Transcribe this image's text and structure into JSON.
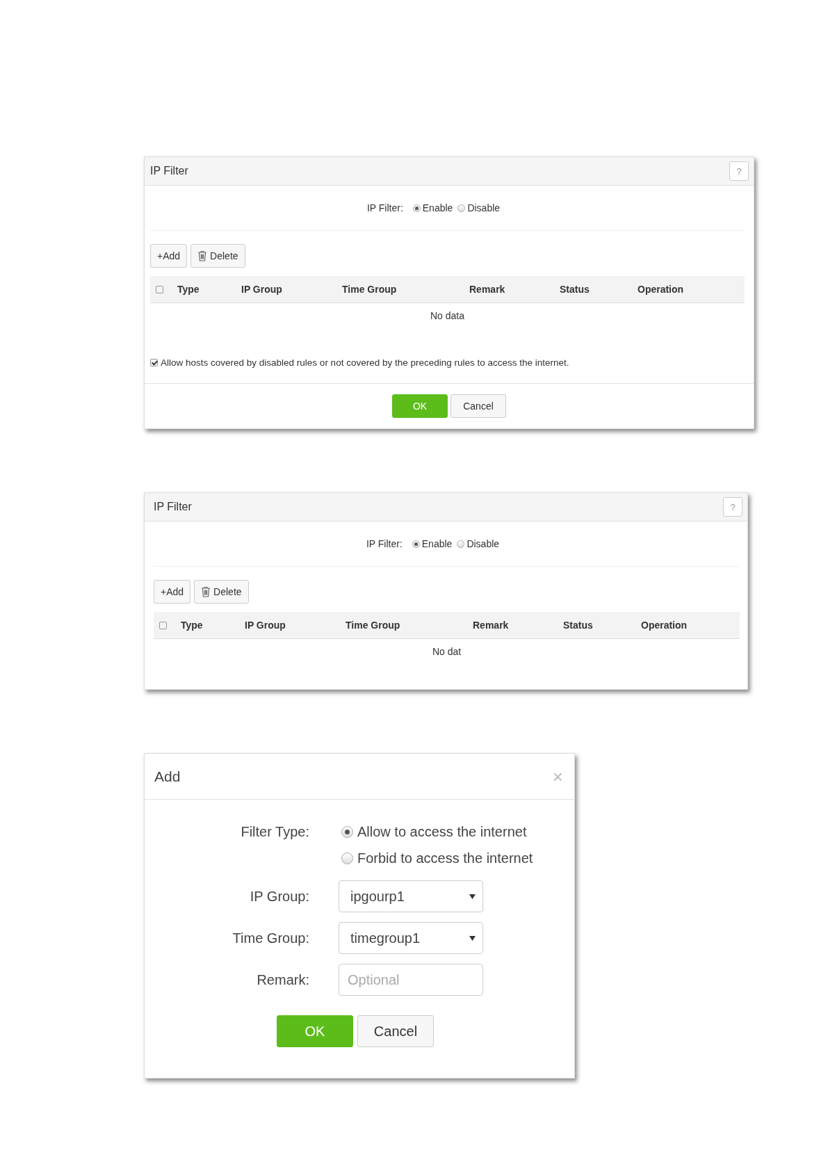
{
  "panels": [
    {
      "kind": "filter",
      "title": "IP Filter",
      "help": "?",
      "switch": {
        "label": "IP Filter:",
        "options": [
          {
            "label": "Enable",
            "selected": true
          },
          {
            "label": "Disable",
            "selected": false
          }
        ]
      },
      "toolbar": [
        {
          "kind": "add",
          "label": "+Add"
        },
        {
          "kind": "delete",
          "label": "Delete"
        }
      ],
      "table": {
        "select_all": {
          "checked": false
        },
        "columns": [
          "Type",
          "IP Group",
          "Time Group",
          "Remark",
          "Status",
          "Operation"
        ],
        "empty_text": "No data"
      },
      "allow_note": {
        "label": "Allow hosts covered by disabled rules or not covered by the preceding rules to access the internet.",
        "checked": true
      },
      "buttons": [
        {
          "kind": "primary",
          "label": "OK"
        },
        {
          "kind": "secondary",
          "label": "Cancel"
        }
      ]
    },
    {
      "kind": "filter",
      "title": "IP Filter",
      "help": "?",
      "switch": {
        "label": "IP Filter:",
        "options": [
          {
            "label": "Enable",
            "selected": true
          },
          {
            "label": "Disable",
            "selected": false
          }
        ]
      },
      "toolbar": [
        {
          "kind": "add",
          "label": "+Add"
        },
        {
          "kind": "delete",
          "label": "Delete"
        }
      ],
      "table": {
        "select_all": {
          "checked": false
        },
        "columns": [
          "Type",
          "IP Group",
          "Time Group",
          "Remark",
          "Status",
          "Operation"
        ],
        "empty_text": "No dat"
      }
    },
    {
      "kind": "dialog",
      "title": "Add",
      "close": "×",
      "fields": [
        {
          "kind": "radio",
          "label": "Filter Type:",
          "options": [
            {
              "label": "Allow to access the internet",
              "selected": true
            },
            {
              "label": "Forbid to access the internet",
              "selected": false
            }
          ]
        },
        {
          "kind": "select",
          "label": "IP Group:",
          "value": "ipgourp1"
        },
        {
          "kind": "select",
          "label": "Time Group:",
          "value": "timegroup1"
        },
        {
          "kind": "text",
          "label": "Remark:",
          "placeholder": "Optional"
        }
      ],
      "buttons": [
        {
          "kind": "primary",
          "label": "OK"
        },
        {
          "kind": "secondary",
          "label": "Cancel"
        }
      ]
    }
  ]
}
